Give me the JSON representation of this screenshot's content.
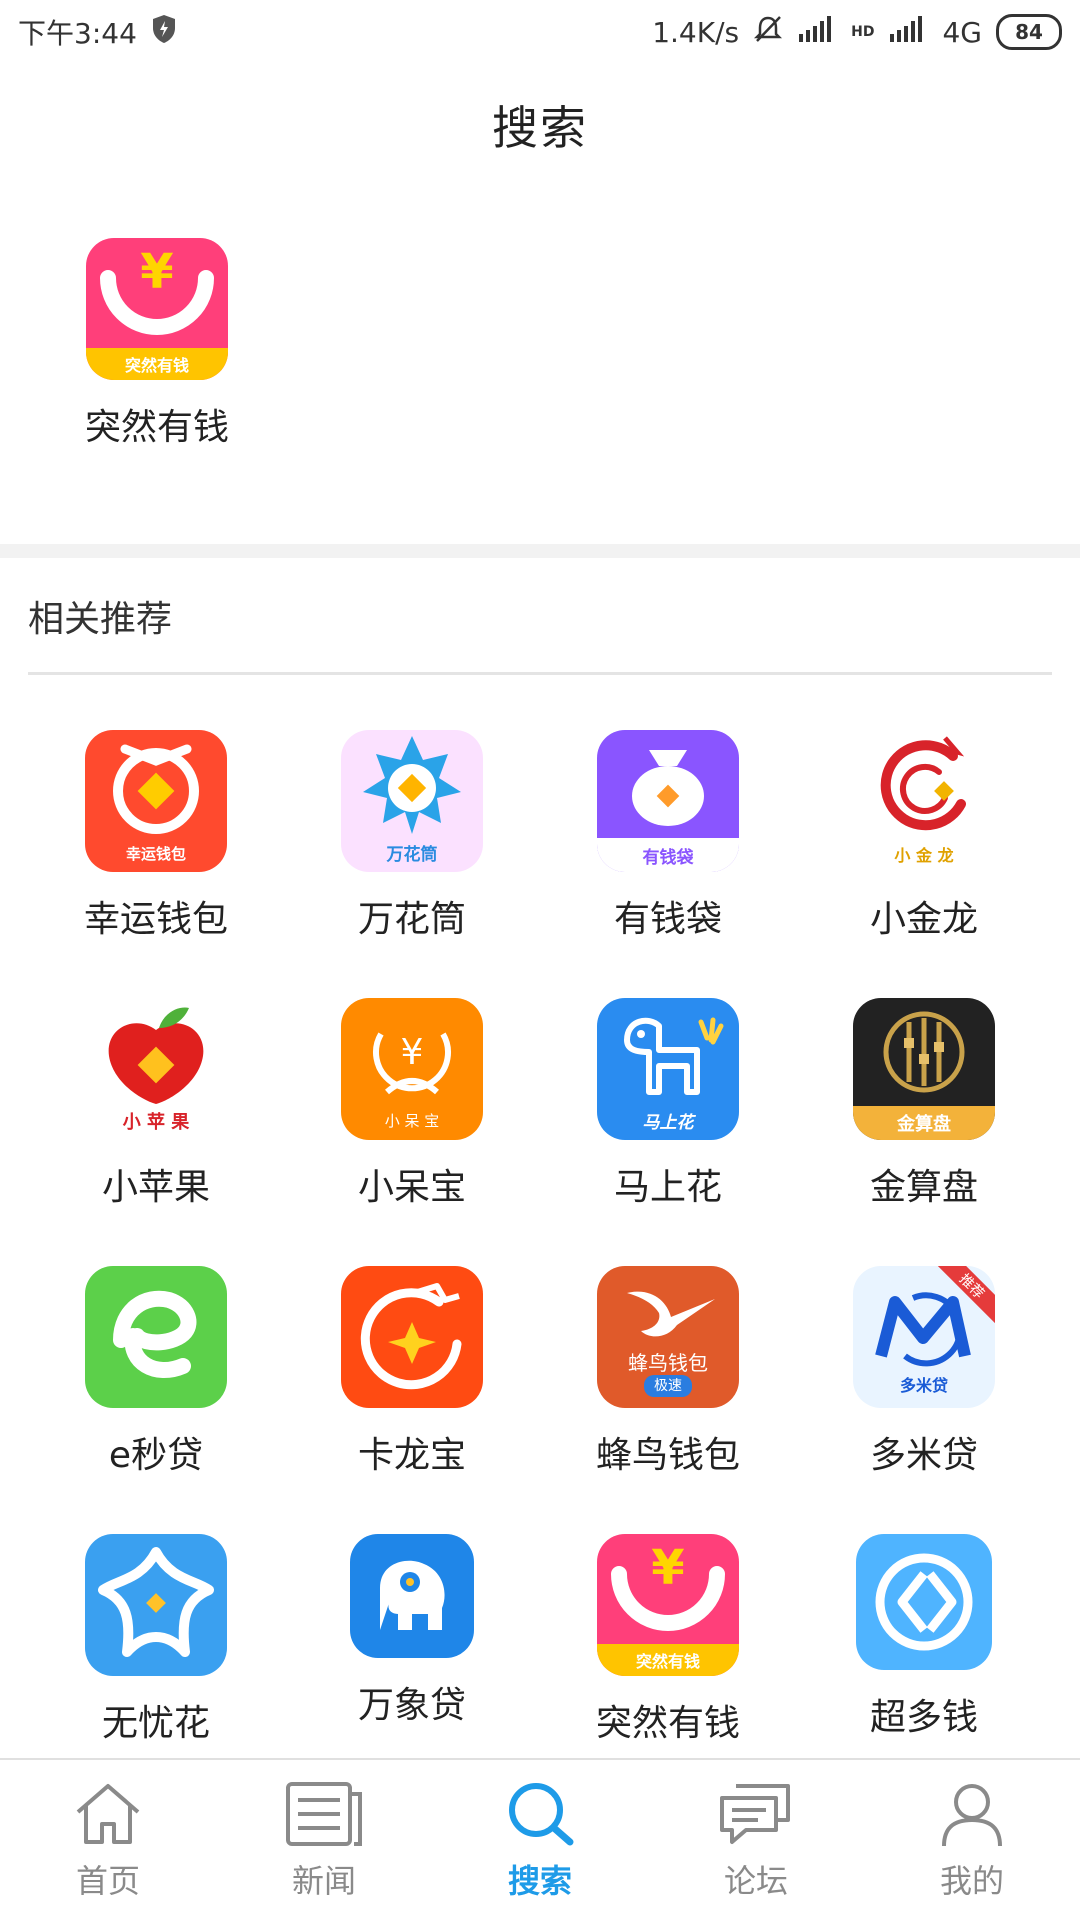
{
  "status": {
    "time": "下午3:44",
    "speed": "1.4K/s",
    "hd": "HD",
    "network": "4G",
    "battery": "84"
  },
  "header": {
    "title": "搜索"
  },
  "result": {
    "name": "突然有钱",
    "badge": "突然有钱",
    "symbol": "¥"
  },
  "section": {
    "title": "相关推荐"
  },
  "apps": [
    {
      "name": "幸运钱包",
      "badge": "幸运钱包",
      "bg": "#ff4a2e"
    },
    {
      "name": "万花筒",
      "badge": "万花筒",
      "bg": "#fbe1ff"
    },
    {
      "name": "有钱袋",
      "badge": "有钱袋",
      "bg": "#8a55ff"
    },
    {
      "name": "小金龙",
      "badge": "小 金 龙",
      "bg": "#ffffff"
    },
    {
      "name": "小苹果",
      "badge": "小 苹 果",
      "bg": "#ffffff"
    },
    {
      "name": "小呆宝",
      "badge": "小 呆 宝",
      "bg": "#ff8a00"
    },
    {
      "name": "马上花",
      "badge": "马上花",
      "bg": "#2a8cf0"
    },
    {
      "name": "金算盘",
      "badge": "金算盘",
      "bg": "#222222"
    },
    {
      "name": "e秒贷",
      "badge": "",
      "bg": "#5cd04a"
    },
    {
      "name": "卡龙宝",
      "badge": "",
      "bg": "#ff4b12"
    },
    {
      "name": "蜂鸟钱包",
      "badge": "蜂鸟钱包",
      "badge2": "极速",
      "bg": "#e05a2a"
    },
    {
      "name": "多米贷",
      "badge": "多米贷",
      "corner": "推荐",
      "bg": "#e9f4ff"
    },
    {
      "name": "无忧花",
      "badge": "",
      "bg": "#3aa0f0"
    },
    {
      "name": "万象贷",
      "badge": "",
      "bg": "#1f86e8"
    },
    {
      "name": "突然有钱",
      "badge": "突然有钱",
      "symbol": "¥",
      "bg": "#ff3f7a"
    },
    {
      "name": "超多钱",
      "badge": "",
      "bg": "#4fb4ff"
    }
  ],
  "nav": [
    {
      "label": "首页",
      "icon": "home-icon",
      "active": false
    },
    {
      "label": "新闻",
      "icon": "news-icon",
      "active": false
    },
    {
      "label": "搜索",
      "icon": "search-icon",
      "active": true
    },
    {
      "label": "论坛",
      "icon": "forum-icon",
      "active": false
    },
    {
      "label": "我的",
      "icon": "profile-icon",
      "active": false
    }
  ],
  "colors": {
    "accent": "#1e9be8",
    "inactive": "#8a8a8a"
  }
}
